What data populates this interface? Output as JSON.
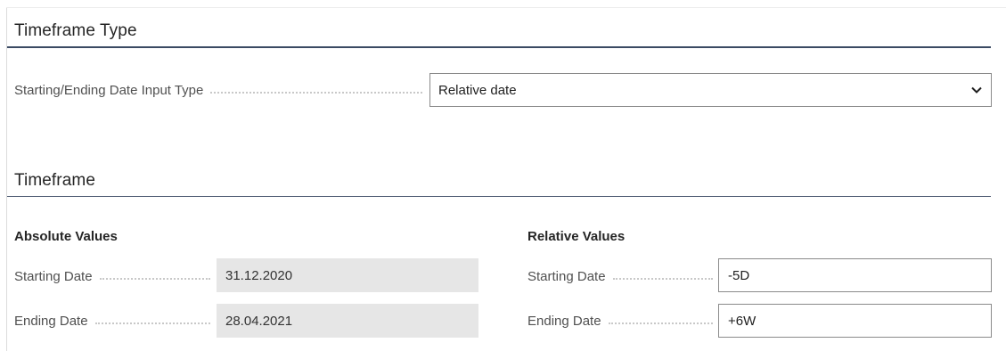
{
  "timeframe_type": {
    "title": "Timeframe Type",
    "input_type_label": "Starting/Ending Date Input Type",
    "input_type_value": "Relative date"
  },
  "timeframe": {
    "title": "Timeframe",
    "absolute": {
      "heading": "Absolute Values",
      "starting_date_label": "Starting Date",
      "starting_date_value": "31.12.2020",
      "ending_date_label": "Ending Date",
      "ending_date_value": "28.04.2021"
    },
    "relative": {
      "heading": "Relative Values",
      "starting_date_label": "Starting Date",
      "starting_date_value": "-5D",
      "ending_date_label": "Ending Date",
      "ending_date_value": "+6W"
    }
  },
  "icons": {
    "dropdown": "chevron-down-icon"
  },
  "colors": {
    "section_rule": "#3b4a63",
    "readonly_field_bg": "#e6e6e6",
    "input_border": "#8a8a8a",
    "label_text": "#505050"
  }
}
